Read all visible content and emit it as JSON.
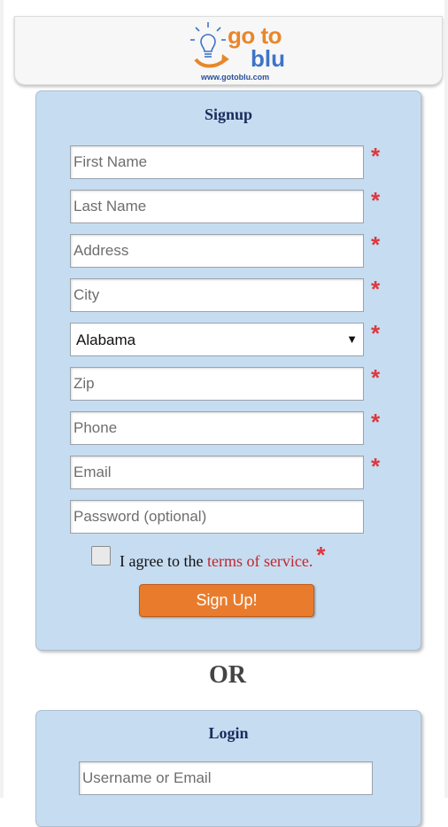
{
  "header": {
    "logo": {
      "line1": "go to",
      "line2": "blu",
      "url": "www.gotoblu.com"
    }
  },
  "signup": {
    "title": "Signup",
    "fields": {
      "first_name": {
        "placeholder": "First Name",
        "value": ""
      },
      "last_name": {
        "placeholder": "Last Name",
        "value": ""
      },
      "address": {
        "placeholder": "Address",
        "value": ""
      },
      "city": {
        "placeholder": "City",
        "value": ""
      },
      "state": {
        "selected": "Alabama"
      },
      "zip": {
        "placeholder": "Zip",
        "value": ""
      },
      "phone": {
        "placeholder": "Phone",
        "value": ""
      },
      "email": {
        "placeholder": "Email",
        "value": ""
      },
      "password": {
        "placeholder": "Password (optional)",
        "value": ""
      }
    },
    "required_mark": "*",
    "agree_text": "I agree to the ",
    "terms_link": "terms of service.",
    "agree_checked": false,
    "button": "Sign Up!"
  },
  "or_text": "OR",
  "login": {
    "title": "Login",
    "username": {
      "placeholder": "Username or Email",
      "value": ""
    }
  },
  "colors": {
    "panel_bg": "#c6dcf1",
    "button_bg": "#e97c2c",
    "required": "#e0363e",
    "title": "#1a2b5c"
  }
}
